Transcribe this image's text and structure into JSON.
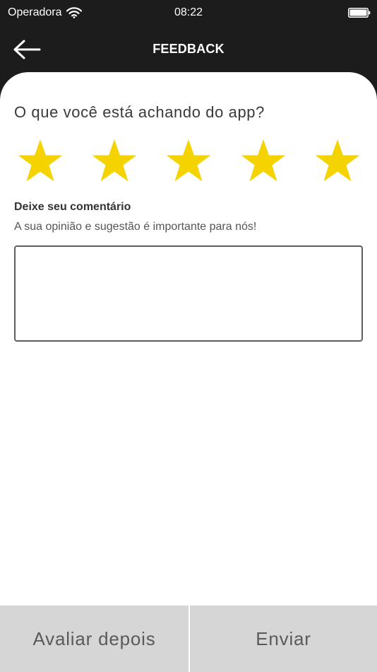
{
  "status_bar": {
    "carrier": "Operadora",
    "time": "08:22",
    "icons": [
      "wifi-icon",
      "battery-icon"
    ]
  },
  "header": {
    "title": "FEEDBACK",
    "back_icon": "arrow-left-icon"
  },
  "main": {
    "question": "O que você está achando do app?",
    "rating": {
      "value": 5,
      "max": 5,
      "star_color": "#F5D300",
      "icon": "star-icon"
    },
    "comment": {
      "label": "Deixe seu comentário",
      "hint": "A sua opinião e sugestão é importante para nós!",
      "value": "",
      "placeholder": ""
    }
  },
  "actions": {
    "later_label": "Avaliar depois",
    "send_label": "Enviar"
  },
  "colors": {
    "header_bg": "#1C1C1C",
    "content_bg": "#FFFFFF",
    "button_bg": "#D6D6D6",
    "button_text": "#5A5A5A"
  }
}
